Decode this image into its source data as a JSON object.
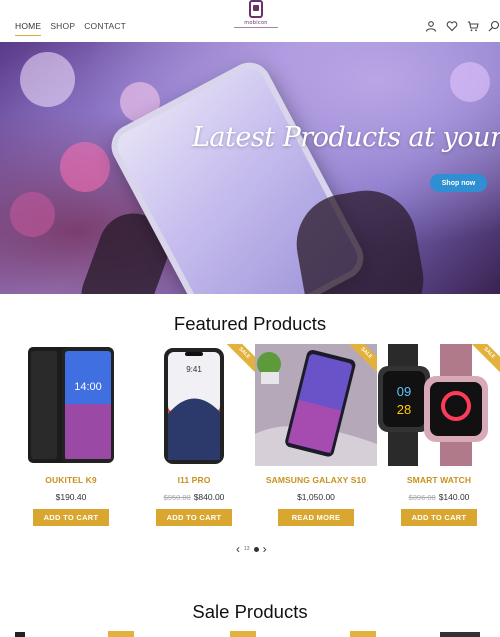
{
  "header": {
    "nav": [
      {
        "label": "HOME",
        "active": true
      },
      {
        "label": "SHOP",
        "active": false
      },
      {
        "label": "CONTACT",
        "active": false
      }
    ],
    "logo_text": "mobicon",
    "icons": [
      "user-icon",
      "heart-icon",
      "cart-icon",
      "search-icon"
    ]
  },
  "hero": {
    "title": "Latest Products at your Doorstep",
    "cta": "Shop now"
  },
  "featured": {
    "title": "Featured Products",
    "products": [
      {
        "name": "OUKITEL K9",
        "old_price": "",
        "price": "$190.40",
        "button": "ADD TO CART",
        "sale": false
      },
      {
        "name": "I11 PRO",
        "old_price": "$950.00",
        "price": "$840.00",
        "button": "ADD TO CART",
        "sale": true
      },
      {
        "name": "SAMSUNG GALAXY S10",
        "old_price": "",
        "price": "$1,050.00",
        "button": "READ MORE",
        "sale": true
      },
      {
        "name": "SMART WATCH",
        "old_price": "$396.00",
        "price": "$140.00",
        "button": "ADD TO CART",
        "sale": true
      }
    ],
    "sale_badge": "SALE",
    "pager": {
      "prev": "‹",
      "current": "13",
      "next": "›"
    }
  },
  "sale": {
    "title": "Sale Products"
  },
  "colors": {
    "accent": "#d9a72f",
    "hero_button": "#2f8fd2",
    "logo": "#6b2f6b"
  }
}
